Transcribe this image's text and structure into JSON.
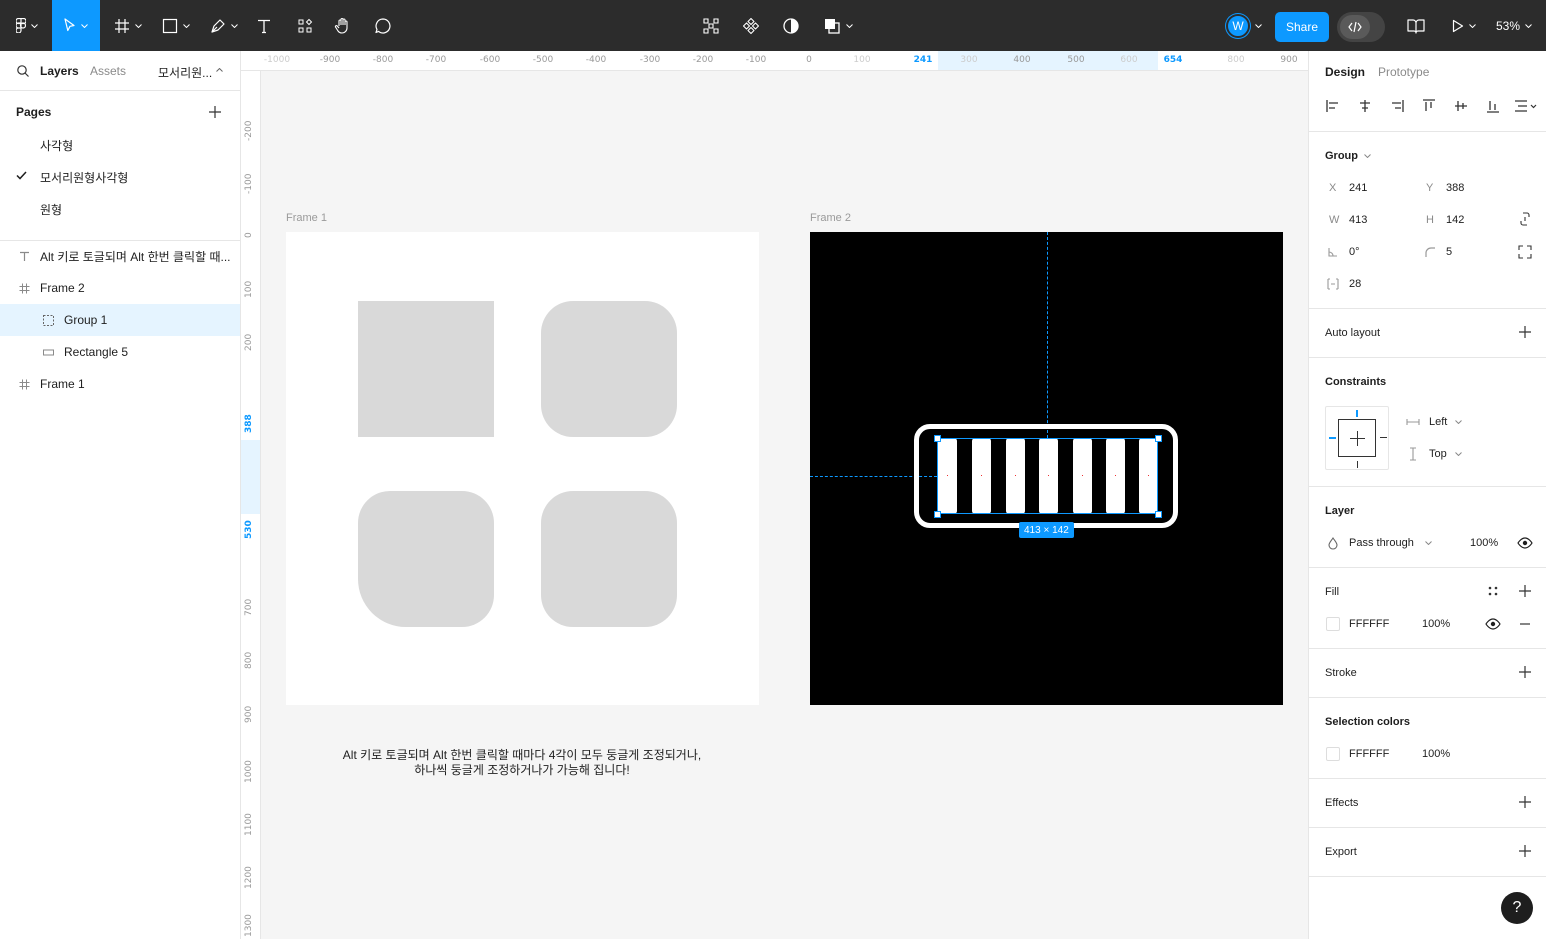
{
  "toolbar": {
    "share_label": "Share",
    "avatar_initial": "W",
    "zoom_label": "53%"
  },
  "left_panel": {
    "tabs": [
      "Layers",
      "Assets"
    ],
    "page_dropdown": "모서리원...",
    "pages_header": "Pages",
    "pages": [
      "사각형",
      "모서리원형사각형",
      "원형"
    ],
    "layers": [
      {
        "name": "Alt 키로 토글되며 Alt 한번 클릭할 때...",
        "icon": "text-icon"
      },
      {
        "name": "Frame 2",
        "icon": "frame-icon"
      },
      {
        "name": "Group 1",
        "icon": "group-icon"
      },
      {
        "name": "Rectangle 5",
        "icon": "rectangle-icon"
      },
      {
        "name": "Frame 1",
        "icon": "frame-icon"
      }
    ]
  },
  "rulers": {
    "top": [
      "-1000",
      "-900",
      "-800",
      "-700",
      "-600",
      "-500",
      "-400",
      "-300",
      "-200",
      "-100",
      "0",
      "100",
      "241",
      "300",
      "400",
      "500",
      "600",
      "654",
      "800",
      "900"
    ],
    "left": [
      "-200",
      "-100",
      "0",
      "100",
      "200",
      "388",
      "530",
      "700",
      "800",
      "900",
      "1000",
      "1100",
      "1200",
      "1300"
    ]
  },
  "canvas": {
    "frame1_label": "Frame 1",
    "frame2_label": "Frame 2",
    "selection_size": "413 × 142",
    "caption_line1": "Alt 키로 토글되며  Alt 한번 클릭할 때마다  4각이 모두 둥글게 조정되거나,",
    "caption_line2": "하나씩 둥글게 조정하거나가 가능해 집니다!"
  },
  "right_panel": {
    "tabs": [
      "Design",
      "Prototype"
    ],
    "group_label": "Group",
    "x_label": "X",
    "x": "241",
    "y_label": "Y",
    "y": "388",
    "w_label": "W",
    "w": "413",
    "h_label": "H",
    "h": "142",
    "rotation": "0°",
    "radius": "5",
    "spacing": "28",
    "auto_layout": "Auto layout",
    "constraints": "Constraints",
    "constraint_h": "Left",
    "constraint_v": "Top",
    "layer": "Layer",
    "blend_mode": "Pass through",
    "layer_opacity": "100%",
    "fill": "Fill",
    "fill_hex": "FFFFFF",
    "fill_opacity": "100%",
    "stroke": "Stroke",
    "selection_colors": "Selection colors",
    "sel_hex": "FFFFFF",
    "sel_opacity": "100%",
    "effects": "Effects",
    "export": "Export"
  },
  "help_label": "?",
  "colors": {
    "accent": "#0d99ff",
    "toolbar_bg": "#2c2c2c",
    "canvas_bg": "#f5f5f5",
    "shape_fill": "#d9d9d9"
  }
}
